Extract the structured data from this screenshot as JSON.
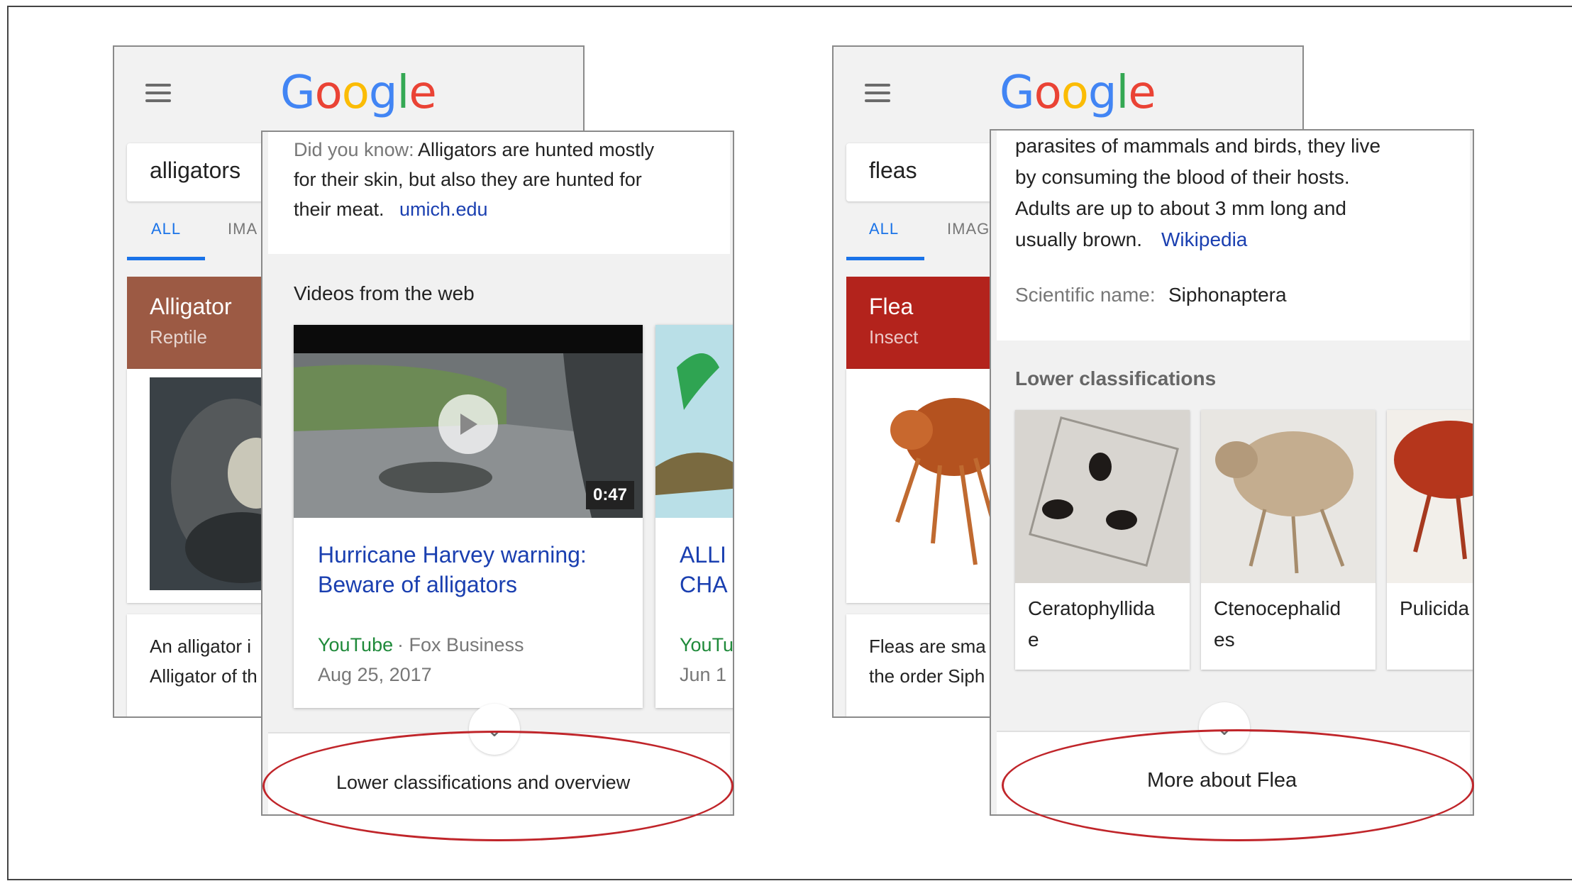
{
  "left": {
    "logo": "Google",
    "query": "alligators",
    "tabs": [
      "ALL",
      "IMA"
    ],
    "entity_title": "Alligator",
    "entity_type": "Reptile",
    "header_color": "#9c5a44",
    "snippet_lines": [
      "An alligator i",
      "Alligator of th"
    ],
    "overlay": {
      "fact_prefix": "Did you know:",
      "fact_line1": " Alligators are hunted mostly",
      "fact_line2": "for their skin, but also they are hunted for",
      "fact_line3": "their meat.",
      "fact_source": "umich.edu",
      "section_title": "Videos from the web",
      "video1": {
        "duration": "0:47",
        "title_line1": "Hurricane Harvey warning:",
        "title_line2": "Beware of alligators",
        "source": "YouTube",
        "channel": " · Fox Business",
        "date": "Aug 25, 2017"
      },
      "video2": {
        "title_line1": "ALLI",
        "title_line2": "CHA",
        "source": "YouTu",
        "date": "Jun 1"
      },
      "more_label": "Lower classifications and overview"
    }
  },
  "right": {
    "logo": "Google",
    "query": "fleas",
    "tabs": [
      "ALL",
      "IMAG"
    ],
    "entity_title": "Flea",
    "entity_type": "Insect",
    "header_color": "#b3231c",
    "snippet_lines": [
      "Fleas are sma",
      "the order Siph"
    ],
    "overlay": {
      "desc_line1": "parasites of mammals and birds, they live",
      "desc_line2": "by consuming the blood of their hosts.",
      "desc_line3": "Adults are up to about 3 mm long and",
      "desc_line4": "usually brown.",
      "desc_source": "Wikipedia",
      "sci_label": "Scientific name:",
      "sci_value": " Siphonaptera",
      "section_title": "Lower classifications",
      "classifications": [
        "Ceratophyllida\ne",
        "Ctenocephalid\nes",
        "Pulicida"
      ],
      "more_label": "More about Flea"
    }
  },
  "colors": {
    "accent_blue": "#1a73e8",
    "annotation_red": "#c0252a"
  }
}
